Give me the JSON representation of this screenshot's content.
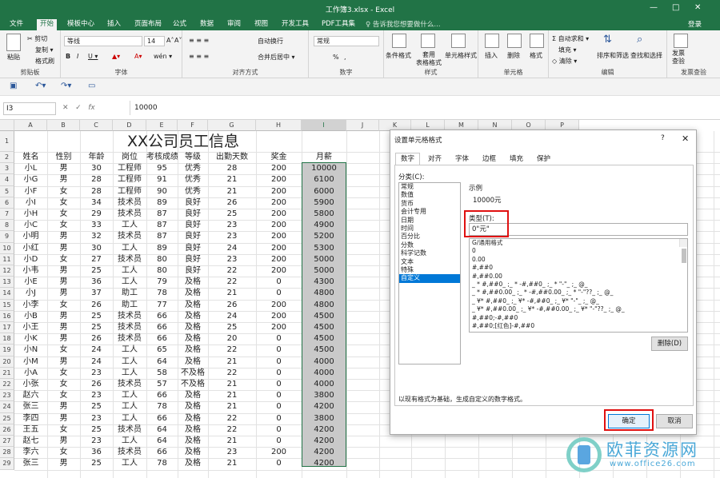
{
  "window": {
    "title": "工作簿3.xlsx - Excel",
    "controls": [
      "—",
      "□",
      "✕"
    ]
  },
  "tabs": [
    "文件",
    "开始",
    "模板中心",
    "插入",
    "页面布局",
    "公式",
    "数据",
    "审阅",
    "视图",
    "开发工具",
    "PDF工具集"
  ],
  "tell_me": "♀ 告诉我您想要做什么...",
  "login": "登录",
  "ribbon": {
    "clipboard": {
      "label": "剪贴板",
      "paste": "粘贴",
      "cut": "✂ 剪切",
      "copy": "复制 ▾",
      "painter": "格式刷"
    },
    "font": {
      "label": "字体",
      "name": "等线",
      "size": "14",
      "bold": "B",
      "italic": "I",
      "underline": "U ▾",
      "grow": "A˄",
      "shrink": "A˅",
      "wen": "wén ▾"
    },
    "align": {
      "label": "对齐方式",
      "wrap": "自动换行",
      "merge": "合并后居中 ▾"
    },
    "number": {
      "label": "数字",
      "format": "常规",
      "percent": "%",
      "comma": ","
    },
    "styles": {
      "label": "样式",
      "cond": "条件格式",
      "table": "套用\n表格格式",
      "cell": "单元格样式"
    },
    "cells": {
      "label": "单元格",
      "insert": "插入",
      "delete": "删除",
      "format": "格式"
    },
    "edit": {
      "label": "编辑",
      "autosum": "Σ 自动求和 ▾",
      "fill": "填充 ▾",
      "clear": "◇ 清除 ▾",
      "sort": "排序和筛选",
      "find": "查找和选择"
    },
    "check": {
      "label": "发票查验",
      "btn": "发票\n查验"
    }
  },
  "formula": {
    "cell_ref": "I3",
    "value": "10000"
  },
  "grid": {
    "columns": [
      "A",
      "B",
      "C",
      "D",
      "E",
      "F",
      "G",
      "H",
      "I",
      "J",
      "K",
      "L",
      "M",
      "N",
      "O",
      "P"
    ],
    "selected_col": "I",
    "title": "XX公司员工信息",
    "headers": [
      "姓名",
      "性别",
      "年龄",
      "岗位",
      "考核成绩",
      "等级",
      "出勤天数",
      "奖金",
      "月薪"
    ],
    "rows": [
      [
        "小L",
        "男",
        "30",
        "工程师",
        "95",
        "优秀",
        "28",
        "200",
        "10000"
      ],
      [
        "小G",
        "男",
        "28",
        "工程师",
        "91",
        "优秀",
        "21",
        "200",
        "6100"
      ],
      [
        "小F",
        "女",
        "28",
        "工程师",
        "90",
        "优秀",
        "21",
        "200",
        "6000"
      ],
      [
        "小I",
        "女",
        "34",
        "技术员",
        "89",
        "良好",
        "26",
        "200",
        "5900"
      ],
      [
        "小H",
        "女",
        "29",
        "技术员",
        "87",
        "良好",
        "25",
        "200",
        "5800"
      ],
      [
        "小C",
        "女",
        "33",
        "工人",
        "87",
        "良好",
        "23",
        "200",
        "4900"
      ],
      [
        "小明",
        "男",
        "32",
        "技术员",
        "87",
        "良好",
        "23",
        "200",
        "5200"
      ],
      [
        "小红",
        "男",
        "30",
        "工人",
        "89",
        "良好",
        "24",
        "200",
        "5300"
      ],
      [
        "小D",
        "女",
        "27",
        "技术员",
        "80",
        "良好",
        "23",
        "200",
        "5000"
      ],
      [
        "小韦",
        "男",
        "25",
        "工人",
        "80",
        "良好",
        "22",
        "200",
        "5000"
      ],
      [
        "小E",
        "男",
        "36",
        "工人",
        "79",
        "及格",
        "22",
        "0",
        "4300"
      ],
      [
        "小J",
        "男",
        "37",
        "助工",
        "78",
        "及格",
        "21",
        "0",
        "4800"
      ],
      [
        "小李",
        "女",
        "26",
        "助工",
        "77",
        "及格",
        "26",
        "200",
        "4800"
      ],
      [
        "小B",
        "男",
        "25",
        "技术员",
        "66",
        "及格",
        "24",
        "200",
        "4500"
      ],
      [
        "小王",
        "男",
        "25",
        "技术员",
        "66",
        "及格",
        "25",
        "200",
        "4500"
      ],
      [
        "小K",
        "男",
        "26",
        "技术员",
        "66",
        "及格",
        "20",
        "0",
        "4500"
      ],
      [
        "小N",
        "女",
        "24",
        "工人",
        "65",
        "及格",
        "22",
        "0",
        "4500"
      ],
      [
        "小M",
        "男",
        "24",
        "工人",
        "64",
        "及格",
        "21",
        "0",
        "4000"
      ],
      [
        "小A",
        "女",
        "23",
        "工人",
        "58",
        "不及格",
        "22",
        "0",
        "4000"
      ],
      [
        "小张",
        "女",
        "26",
        "技术员",
        "57",
        "不及格",
        "21",
        "0",
        "4000"
      ],
      [
        "赵六",
        "女",
        "23",
        "工人",
        "66",
        "及格",
        "21",
        "0",
        "3800"
      ],
      [
        "张三",
        "男",
        "25",
        "工人",
        "78",
        "及格",
        "21",
        "0",
        "4200"
      ],
      [
        "李四",
        "男",
        "23",
        "工人",
        "66",
        "及格",
        "22",
        "0",
        "3800"
      ],
      [
        "王五",
        "女",
        "25",
        "技术员",
        "64",
        "及格",
        "22",
        "0",
        "4200"
      ],
      [
        "赵七",
        "男",
        "23",
        "工人",
        "64",
        "及格",
        "21",
        "0",
        "4200"
      ],
      [
        "李六",
        "女",
        "36",
        "技术员",
        "66",
        "及格",
        "23",
        "200",
        "4200"
      ],
      [
        "张三",
        "男",
        "25",
        "工人",
        "78",
        "及格",
        "21",
        "0",
        "4200"
      ]
    ]
  },
  "dialog": {
    "title": "设置单元格格式",
    "help": "?",
    "close": "✕",
    "tabs": [
      "数字",
      "对齐",
      "字体",
      "边框",
      "填充",
      "保护"
    ],
    "category_label": "分类(C):",
    "categories": [
      "常规",
      "数值",
      "货币",
      "会计专用",
      "日期",
      "时间",
      "百分比",
      "分数",
      "科学记数",
      "文本",
      "特殊",
      "自定义"
    ],
    "selected_category": "自定义",
    "sample_label": "示例",
    "sample_value": "10000元",
    "type_label": "类型(T):",
    "type_value": "0\"元\"",
    "formats": [
      "G/通用格式",
      "0",
      "0.00",
      "#,##0",
      "#,##0.00",
      "_ * #,##0_ ;_ * -#,##0_ ;_ * \"-\"_ ;_ @_",
      "_ * #,##0.00_ ;_ * -#,##0.00_ ;_ * \"-\"??_ ;_ @_",
      "_ ¥* #,##0_ ;_ ¥* -#,##0_ ;_ ¥* \"-\"_ ;_ @_",
      "_ ¥* #,##0.00_ ;_ ¥* -#,##0.00_ ;_ ¥* \"-\"??_ ;_ @_",
      "#,##0;-#,##0",
      "#,##0;[红色]-#,##0"
    ],
    "delete_btn": "删除(D)",
    "hint": "以现有格式为基础，生成自定义的数字格式。",
    "ok": "确定",
    "cancel": "取消"
  },
  "watermark": {
    "cn": "欧菲资源网",
    "url": "www.office26.com"
  },
  "colors": {
    "excel_green": "#217346",
    "red_highlight": "#e01010"
  }
}
